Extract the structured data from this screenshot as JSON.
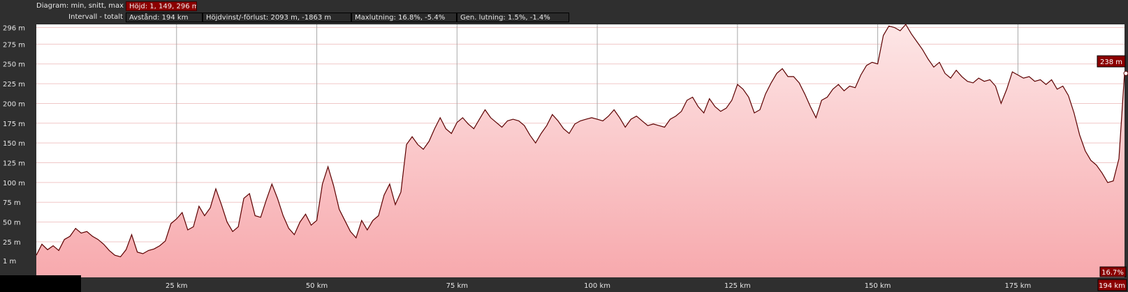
{
  "header": {
    "row1_label": "Diagram: min, snitt, max",
    "row1_box": "Höjd: 1, 149, 296 m",
    "row2_label": "Intervall - totalt",
    "row2_boxes": [
      "Avstånd: 194 km",
      "Höjdvinst/-förlust: 2093 m, -1863 m",
      "Maxlutning: 16.8%, -5.4%",
      "Gen. lutning: 1.5%, -1.4%"
    ]
  },
  "markers": {
    "current_height": "238 m",
    "current_slope": "16.7%",
    "current_distance": "194 km"
  },
  "colors": {
    "line": "#5c0000",
    "fill_top": "#fde6e6",
    "fill_bottom": "#f7a9ad",
    "grid_h": "#f0c7c7",
    "grid_v": "#a9a9a9",
    "marker_bg": "#8b0000"
  },
  "chart_data": {
    "type": "area",
    "title": "",
    "xlabel": "",
    "ylabel": "",
    "xlim": [
      0,
      194
    ],
    "ylim": [
      -20,
      300
    ],
    "yticks": [
      1,
      25,
      50,
      75,
      100,
      125,
      150,
      175,
      200,
      225,
      250,
      275,
      296
    ],
    "ytick_labels": [
      "1 m",
      "25 m",
      "50 m",
      "75 m",
      "100 m",
      "125 m",
      "150 m",
      "175 m",
      "200 m",
      "225 m",
      "250 m",
      "275 m",
      "296 m"
    ],
    "xticks": [
      25,
      50,
      75,
      100,
      125,
      150,
      175
    ],
    "xtick_labels": [
      "25 km",
      "50 km",
      "75 km",
      "100 km",
      "125 km",
      "150 km",
      "175 km"
    ],
    "grid": true,
    "series": [
      {
        "x": [
          0,
          1,
          2,
          3,
          4,
          5,
          6,
          7,
          8,
          9,
          10,
          11,
          12,
          13,
          14,
          15,
          16,
          17,
          18,
          19,
          20,
          21,
          22,
          23,
          24,
          25,
          26,
          27,
          28,
          29,
          30,
          31,
          32,
          33,
          34,
          35,
          36,
          37,
          38,
          39,
          40,
          41,
          42,
          43,
          44,
          45,
          46,
          47,
          48,
          49,
          50,
          51,
          52,
          53,
          54,
          55,
          56,
          57,
          58,
          59,
          60,
          61,
          62,
          63,
          64,
          65,
          66,
          67,
          68,
          69,
          70,
          71,
          72,
          73,
          74,
          75,
          76,
          77,
          78,
          79,
          80,
          81,
          82,
          83,
          84,
          85,
          86,
          87,
          88,
          89,
          90,
          91,
          92,
          93,
          94,
          95,
          96,
          97,
          98,
          99,
          100,
          101,
          102,
          103,
          104,
          105,
          106,
          107,
          108,
          109,
          110,
          111,
          112,
          113,
          114,
          115,
          116,
          117,
          118,
          119,
          120,
          121,
          122,
          123,
          124,
          125,
          126,
          127,
          128,
          129,
          130,
          131,
          132,
          133,
          134,
          135,
          136,
          137,
          138,
          139,
          140,
          141,
          142,
          143,
          144,
          145,
          146,
          147,
          148,
          149,
          150,
          151,
          152,
          153,
          154,
          155,
          156,
          157,
          158,
          159,
          160,
          161,
          162,
          163,
          164,
          165,
          166,
          167,
          168,
          169,
          170,
          171,
          172,
          173,
          174,
          175,
          176,
          177,
          178,
          179,
          180,
          181,
          182,
          183,
          184,
          185,
          186,
          187,
          188,
          189,
          190,
          191,
          192,
          193,
          194
        ],
        "y": [
          8,
          22,
          15,
          20,
          14,
          28,
          32,
          42,
          36,
          38,
          32,
          28,
          22,
          14,
          8,
          6,
          15,
          34,
          12,
          10,
          14,
          16,
          20,
          26,
          48,
          54,
          62,
          40,
          44,
          70,
          58,
          68,
          92,
          72,
          50,
          38,
          44,
          80,
          86,
          58,
          56,
          78,
          98,
          80,
          58,
          42,
          34,
          50,
          60,
          46,
          52,
          98,
          120,
          96,
          66,
          52,
          38,
          30,
          52,
          40,
          52,
          58,
          84,
          98,
          72,
          88,
          148,
          158,
          148,
          142,
          152,
          168,
          182,
          168,
          162,
          176,
          182,
          174,
          168,
          180,
          192,
          182,
          176,
          170,
          178,
          180,
          178,
          172,
          160,
          150,
          162,
          172,
          186,
          178,
          168,
          162,
          174,
          178,
          180,
          182,
          180,
          178,
          184,
          192,
          182,
          170,
          180,
          184,
          178,
          172,
          174,
          172,
          170,
          180,
          184,
          190,
          204,
          208,
          196,
          188,
          206,
          196,
          190,
          194,
          204,
          224,
          218,
          208,
          188,
          192,
          212,
          226,
          238,
          244,
          234,
          234,
          226,
          212,
          196,
          182,
          204,
          208,
          218,
          224,
          216,
          222,
          220,
          236,
          248,
          252,
          250,
          286,
          298,
          296,
          292,
          300,
          288,
          278,
          268,
          256,
          246,
          252,
          238,
          232,
          242,
          234,
          228,
          226,
          232,
          228,
          230,
          222,
          200,
          218,
          240,
          236,
          232,
          234,
          228,
          230,
          224,
          230,
          218,
          222,
          210,
          188,
          160,
          140,
          128,
          122,
          112,
          100,
          102,
          130,
          238
        ]
      }
    ]
  }
}
